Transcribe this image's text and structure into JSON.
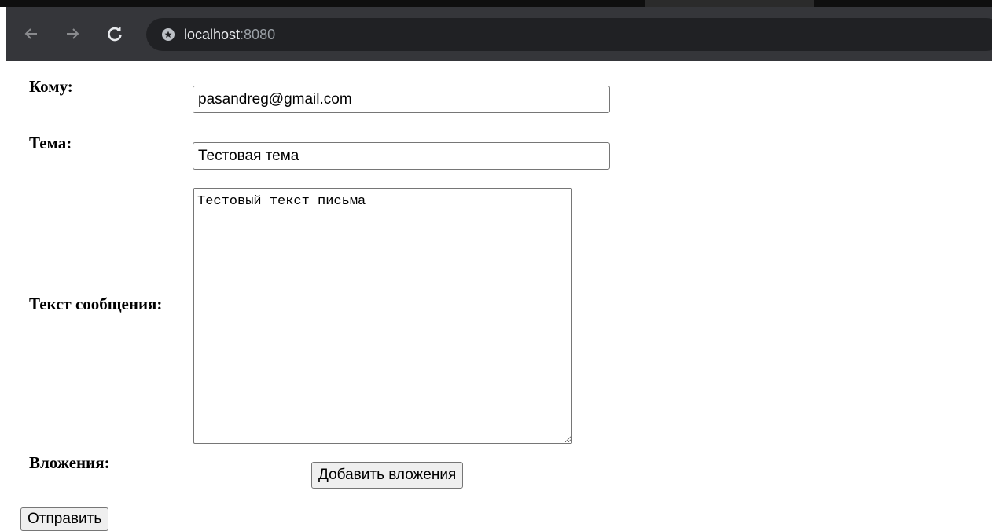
{
  "browser": {
    "url_host": "localhost",
    "url_port": ":8080"
  },
  "form": {
    "to_label": "Кому:",
    "to_value": "pasandreg@gmail.com",
    "subject_label": "Тема:",
    "subject_value": "Тестовая тема",
    "body_label": "Текст сообщения:",
    "body_value": "Тестовый текст письма",
    "attachments_label": "Вложения:",
    "add_attachments_button": "Добавить вложения",
    "send_button": "Отправить"
  }
}
